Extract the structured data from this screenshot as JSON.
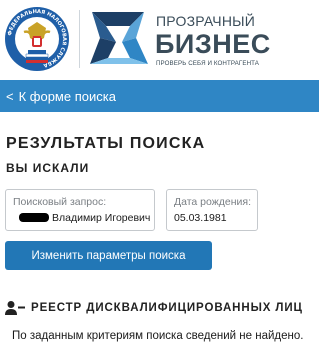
{
  "header": {
    "emblem_icon": "fns-emblem-icon",
    "emblem_ring_text": "ФЕДЕРАЛЬНАЯ НАЛОГОВАЯ СЛУЖБА",
    "logo_icon": "transparent-business-logo-icon",
    "brand_top": "ПРОЗРАЧНЫЙ",
    "brand_main": "БИЗНЕС",
    "brand_sub": "ПРОВЕРЬ СЕБЯ И КОНТРАГЕНТА"
  },
  "nav": {
    "back_label": "К форме поиска",
    "back_icon": "chevron-left-icon",
    "bg_color": "#2f86c5"
  },
  "results": {
    "title": "РЕЗУЛЬТАТЫ ПОИСКА",
    "subtitle": "ВЫ ИСКАЛИ",
    "query_label": "Поисковый запрос:",
    "query_value": "Владимир Игоревич",
    "dob_label": "Дата рождения:",
    "dob_value": "05.03.1981",
    "change_button": "Изменить параметры поиска"
  },
  "registry": {
    "icon": "person-minus-icon",
    "title": "РЕЕСТР ДИСКВАЛИФИЦИРОВАННЫХ ЛИЦ",
    "message": "По заданным критериям поиска сведений не найдено."
  }
}
